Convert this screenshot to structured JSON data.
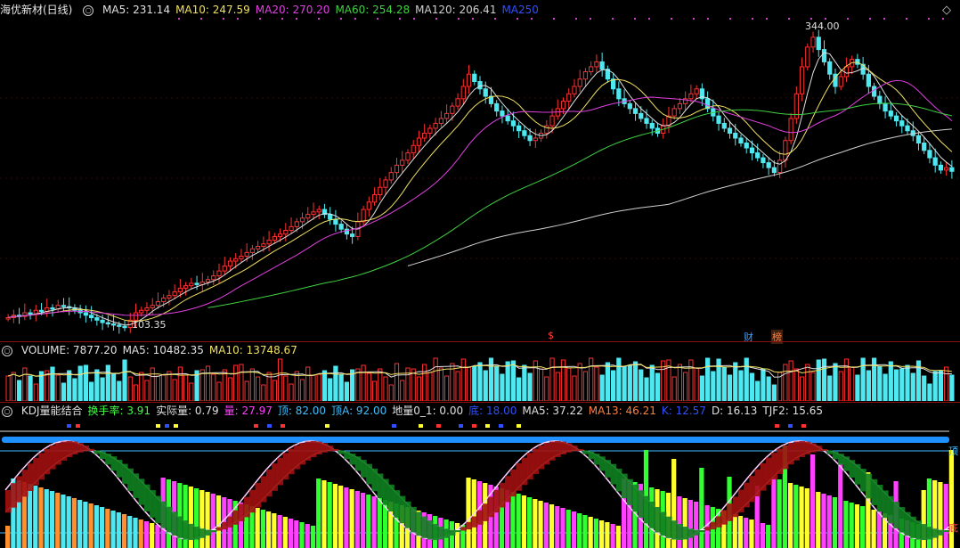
{
  "main": {
    "title": "海优新材(日线)",
    "ma_labels": [
      {
        "text": "MA5: 231.14",
        "color": "#e0e0e0"
      },
      {
        "text": "MA10: 247.59",
        "color": "#f0e060"
      },
      {
        "text": "MA20: 270.20",
        "color": "#e040e0"
      },
      {
        "text": "MA60: 254.28",
        "color": "#40d040"
      },
      {
        "text": "MA120: 206.41",
        "color": "#d0d0d0"
      },
      {
        "text": "MA250",
        "color": "#3050ff"
      }
    ],
    "high_label": "344.00",
    "low_label": "103.35",
    "tags": [
      {
        "text": "$",
        "color": "#ff4040"
      },
      {
        "text": "财",
        "color": "#40a0ff"
      },
      {
        "text": "榜",
        "color": "#ff8040"
      }
    ]
  },
  "volume": {
    "labels": [
      {
        "text": "VOLUME: 7877.20",
        "color": "#e0e0e0"
      },
      {
        "text": "MA5: 10482.35",
        "color": "#e0e0e0"
      },
      {
        "text": "MA10: 13748.67",
        "color": "#f0e060"
      }
    ]
  },
  "kdj": {
    "labels": [
      {
        "text": "KDJ量能结合",
        "color": "#e0e0e0"
      },
      {
        "text": "换手率: 3.91",
        "color": "#40ff40"
      },
      {
        "text": "实际量: 0.79",
        "color": "#e0e0e0"
      },
      {
        "text": "量: 27.97",
        "color": "#ff40ff"
      },
      {
        "text": "顶: 82.00",
        "color": "#40c0ff"
      },
      {
        "text": "顶A: 92.00",
        "color": "#40c0ff"
      },
      {
        "text": "地量0_1: 0.00",
        "color": "#e0e0e0"
      },
      {
        "text": "底: 18.00",
        "color": "#3050ff"
      },
      {
        "text": "MA5: 37.22",
        "color": "#e0e0e0"
      },
      {
        "text": "MA13: 46.21",
        "color": "#ff8040"
      },
      {
        "text": "K: 12.57",
        "color": "#3050ff"
      },
      {
        "text": "D: 16.13",
        "color": "#e0e0e0"
      },
      {
        "text": "TJF2: 15.65",
        "color": "#e0e0e0"
      }
    ],
    "top_marker": "顶",
    "bottom_marker": "底"
  },
  "chart_data": {
    "type": "candlestick",
    "closes": [
      112,
      114,
      113,
      116,
      115,
      118,
      117,
      120,
      119,
      122,
      121,
      120,
      118,
      116,
      114,
      112,
      110,
      108,
      107,
      106,
      105,
      104,
      110,
      116,
      118,
      120,
      122,
      125,
      128,
      130,
      133,
      136,
      138,
      140,
      139,
      141,
      143,
      146,
      150,
      154,
      158,
      160,
      162,
      165,
      168,
      170,
      172,
      175,
      178,
      180,
      183,
      186,
      190,
      193,
      196,
      198,
      200,
      196,
      192,
      188,
      184,
      180,
      178,
      190,
      200,
      206,
      212,
      218,
      224,
      230,
      236,
      240,
      246,
      252,
      258,
      262,
      266,
      270,
      274,
      278,
      284,
      290,
      300,
      310,
      304,
      298,
      292,
      286,
      280,
      276,
      272,
      268,
      264,
      260,
      256,
      258,
      262,
      268,
      276,
      282,
      288,
      294,
      300,
      306,
      312,
      316,
      320,
      314,
      306,
      298,
      290,
      286,
      282,
      278,
      274,
      270,
      266,
      262,
      268,
      276,
      282,
      286,
      290,
      294,
      298,
      290,
      282,
      276,
      270,
      266,
      262,
      258,
      254,
      250,
      246,
      242,
      238,
      234,
      230,
      240,
      256,
      274,
      294,
      316,
      332,
      340,
      330,
      320,
      310,
      300,
      308,
      316,
      322,
      318,
      310,
      300,
      292,
      286,
      280,
      276,
      272,
      268,
      264,
      260,
      254,
      248,
      242,
      236,
      232,
      234,
      231
    ],
    "price_range": [
      95,
      350
    ],
    "high": 344.0,
    "low": 103.35
  }
}
